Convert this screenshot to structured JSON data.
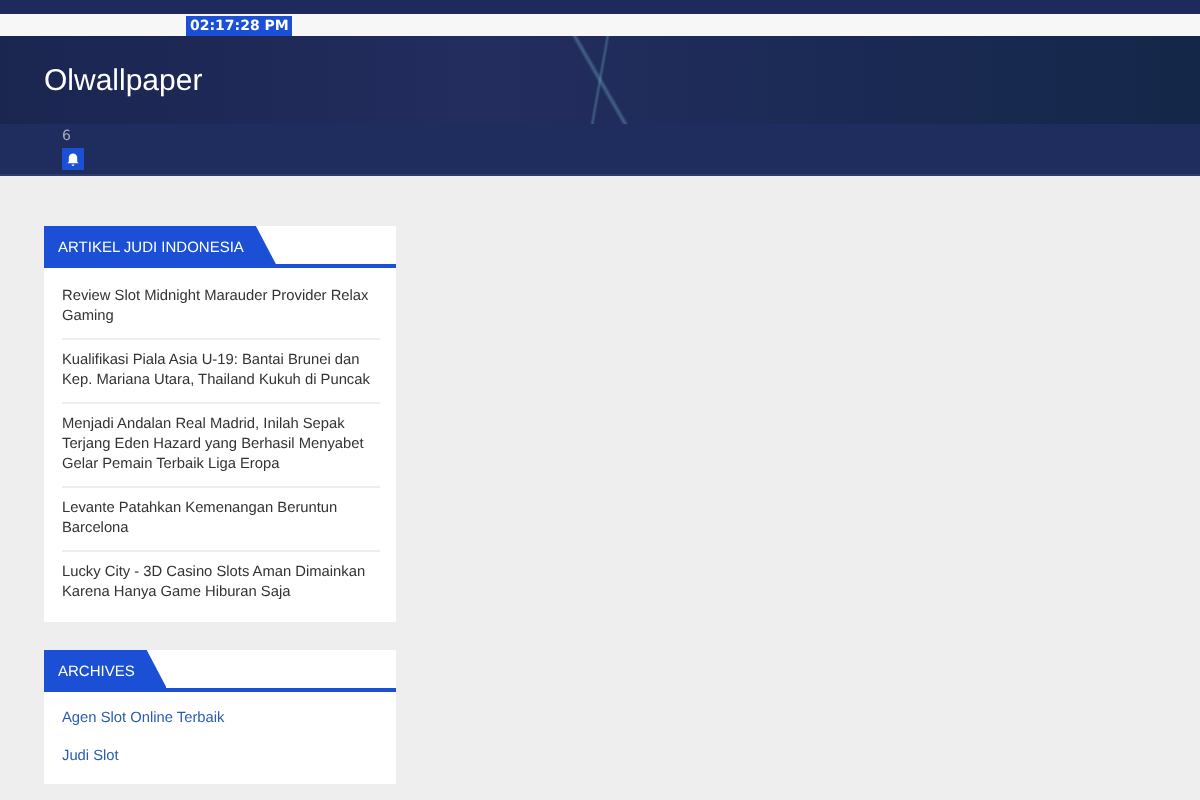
{
  "top_bar": {
    "clock": "02:17:28 PM"
  },
  "header": {
    "site_title": "Olwallpaper"
  },
  "nav": {
    "count": "6"
  },
  "widgets": [
    {
      "title": "ARTIKEL JUDI INDONESIA",
      "kind": "posts",
      "items": [
        "Review Slot Midnight Marauder Provider Relax Gaming",
        "Kualifikasi Piala Asia U-19: Bantai Brunei dan Kep. Mariana Utara, Thailand Kukuh di Puncak",
        "Menjadi Andalan Real Madrid, Inilah Sepak Terjang Eden Hazard yang Berhasil Menyabet Gelar Pemain Terbaik Liga Eropa",
        "Levante Patahkan Kemenangan Beruntun Barcelona",
        "Lucky City - 3D Casino Slots Aman Dimainkan Karena Hanya Game Hiburan Saja"
      ]
    },
    {
      "title": "ARCHIVES",
      "kind": "links",
      "items": [
        "Agen Slot Online Terbaik",
        "Judi Slot"
      ]
    }
  ]
}
